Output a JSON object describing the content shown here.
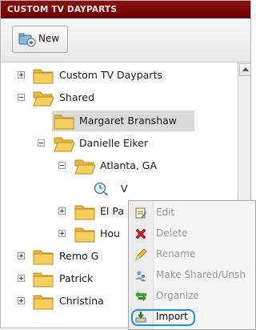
{
  "panel": {
    "title": "CUSTOM TV DAYPARTS"
  },
  "toolbar": {
    "new_label": "New"
  },
  "tree": {
    "custom_tv_dayparts": "Custom TV Dayparts",
    "shared": "Shared",
    "margaret": "Margaret Branshaw",
    "danielle": "Danielle Eiker",
    "atlanta": "Atlanta, GA",
    "item_v": "V",
    "el_pa": "El Pa",
    "hou": "Hou",
    "remo": "Remo G",
    "patrick": "Patrick",
    "christina": "Christina"
  },
  "context_menu": {
    "items": [
      {
        "label": "Edit",
        "icon": "edit-icon",
        "enabled": false
      },
      {
        "label": "Delete",
        "icon": "delete-icon",
        "enabled": false
      },
      {
        "label": "Rename",
        "icon": "rename-pencil-icon",
        "enabled": false
      },
      {
        "label": "Make Shared/Unsh",
        "icon": "share-users-icon",
        "enabled": false
      },
      {
        "label": "Organize",
        "icon": "organize-arrows-icon",
        "enabled": false
      },
      {
        "label": "Import",
        "icon": "import-icon",
        "enabled": true
      }
    ],
    "highlight_color": "#1e90e0"
  },
  "colors": {
    "title_bar": "#7a0a0a",
    "folder": "#f1c74f"
  }
}
